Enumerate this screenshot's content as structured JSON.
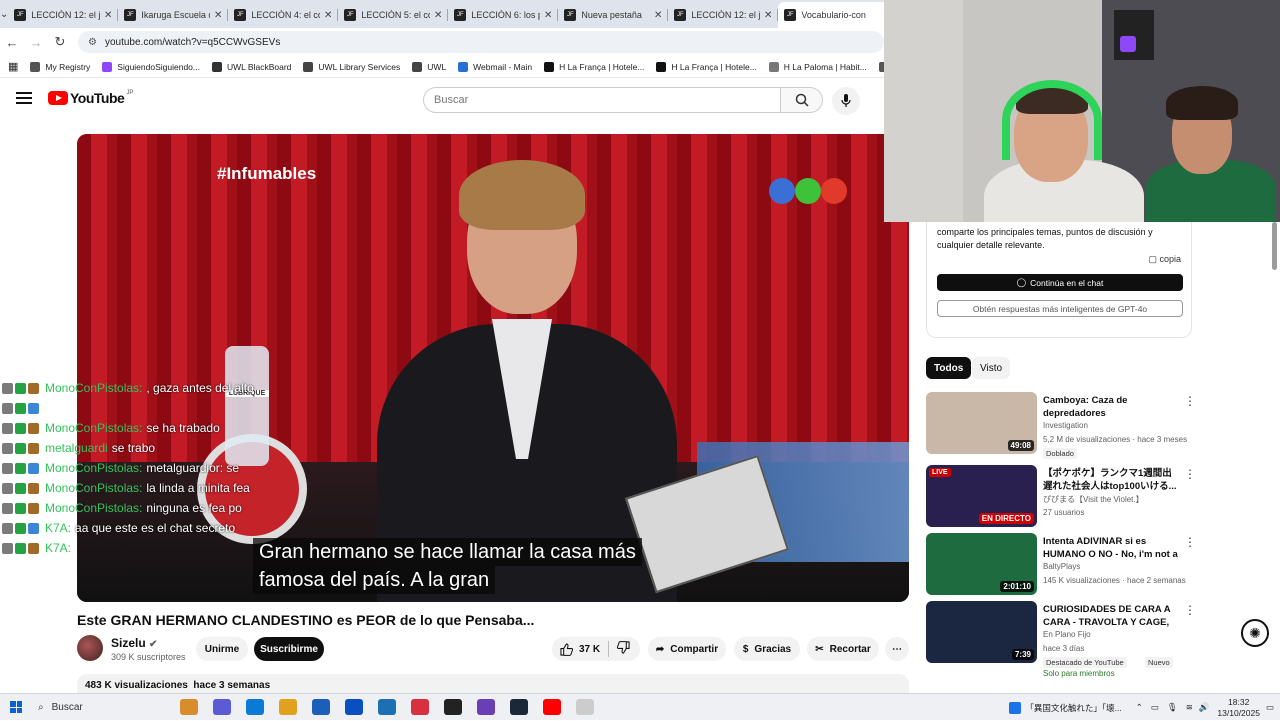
{
  "browser": {
    "tabs": [
      {
        "label": "LECCIÓN 12: el ja",
        "active": false
      },
      {
        "label": "Ikaruga Escuela d",
        "active": false
      },
      {
        "label": "LECCIÓN 4: el cor",
        "active": false
      },
      {
        "label": "LECCIÓN 5: el cor",
        "active": false
      },
      {
        "label": "LECCIÓN 6: los pr",
        "active": false
      },
      {
        "label": "Nueva pestaña",
        "active": false
      },
      {
        "label": "LECCIÓN 12: el ja",
        "active": false
      },
      {
        "label": "Vocabulario-con",
        "active": true
      }
    ],
    "url": "youtube.com/watch?v=q5CCWvGSEVs",
    "bookmarks": [
      {
        "label": "My Registry",
        "color": "#555555"
      },
      {
        "label": "SiguiendoSiguiendo...",
        "color": "#8e48f7"
      },
      {
        "label": "UWL BlackBoard",
        "color": "#333333"
      },
      {
        "label": "UWL Library Services",
        "color": "#444444"
      },
      {
        "label": "UWL",
        "color": "#444444"
      },
      {
        "label": "Webmail - Main",
        "color": "#2a6fd6"
      },
      {
        "label": "H La França | Hotele...",
        "color": "#111111"
      },
      {
        "label": "H La França | Hotele...",
        "color": "#111111"
      },
      {
        "label": "H La Paloma | Habit...",
        "color": "#777777"
      },
      {
        "label": "Posiciones",
        "color": "#555555"
      }
    ]
  },
  "youtube": {
    "logo_text": "YouTube",
    "logo_region": "JP",
    "search_placeholder": "Buscar"
  },
  "video": {
    "hashtag": "#Infumables",
    "caption_line1": "Gran hermano se hace llamar la casa más",
    "caption_line2": "famosa del país. A la gran",
    "bottle_label": "LUBRIQUE"
  },
  "chat": [
    {
      "user": "MonoConPistolas:",
      "text": ", gaza antes del alto"
    },
    {
      "user": "",
      "text": ""
    },
    {
      "user": "MonoConPistolas:",
      "text": "se ha trabado"
    },
    {
      "user": "metalguardi",
      "text": "se trabo"
    },
    {
      "user": "MonoConPistolas:",
      "text": "metalguardior: se"
    },
    {
      "user": "MonoConPistolas:",
      "text": "la linda a minita fea"
    },
    {
      "user": "MonoConPistolas:",
      "text": "ninguna es fea po"
    },
    {
      "user": "K7A:",
      "text": "aa que este es el chat secreto"
    },
    {
      "user": "K7A:",
      "text": ""
    }
  ],
  "video_info": {
    "title": "Este GRAN HERMANO CLANDESTINO es PEOR de lo que Pensaba...",
    "channel": "Sizelu",
    "subscribers": "309 K suscriptores",
    "join_label": "Unirme",
    "subscribe_label": "Suscribirme",
    "likes": "37 K",
    "share_label": "Compartir",
    "thanks_label": "Gracias",
    "clip_label": "Recortar",
    "views": "483 K visualizaciones",
    "date": "hace 3 semanas"
  },
  "ai_panel": {
    "text": "comparte los principales temas, puntos de discusión y cualquier detalle relevante.",
    "copy_label": "copia",
    "continue_label": "Continúa en el chat",
    "gpt_label": "Obtén respuestas más inteligentes de GPT-4o"
  },
  "chips": {
    "all": "Todos",
    "seen": "Visto"
  },
  "recommendations": [
    {
      "title": "Camboya: Caza de depredadores",
      "channel": "Investigation",
      "meta": "5,2 M de visualizaciones · hace 3 meses",
      "duration": "49:08",
      "tag": "Doblado",
      "tag2": "",
      "live": "",
      "thumb_color": "#c9b8a8"
    },
    {
      "title": "【ポケポケ】ランクマ1週間出遅れた社会人はtop100いける...",
      "channel": "ぴぴまる【Visit the Violet.】",
      "meta": "27 usuarios",
      "duration": "EN DIRECTO",
      "tag": "",
      "tag2": "",
      "live": "LIVE",
      "thumb_color": "#2a2050"
    },
    {
      "title": "Intenta ADIVINAR si es HUMANO O NO - No, i'm not a ...",
      "channel": "BaltyPlays",
      "meta": "145 K visualizaciones · hace 2 semanas",
      "duration": "2:01:10",
      "tag": "",
      "tag2": "",
      "live": "",
      "thumb_color": "#1d6b3e"
    },
    {
      "title": "CURIOSIDADES DE CARA A CARA - TRAVOLTA Y CAGE, ...",
      "channel": "En Plano Fijo",
      "meta": "hace 3 días",
      "duration": "7:39",
      "tag": "Destacado de YouTube",
      "tag2": "Nuevo",
      "members": "Solo para miembros",
      "live": "",
      "thumb_color": "#1b2740"
    }
  ],
  "taskbar": {
    "search_label": "Buscar",
    "notification": "「異国文化触れた」「壊...",
    "time": "18:32",
    "date": "13/10/2025",
    "icon_colors": [
      "#d98c2b",
      "#5b5bd6",
      "#0a7ad6",
      "#e0a020",
      "#1c5fb8",
      "#0a4ec2",
      "#1c6fb0",
      "#d93040",
      "#222222",
      "#6a3fb5",
      "#1b2838",
      "#ff0000",
      "#cccccc"
    ]
  }
}
